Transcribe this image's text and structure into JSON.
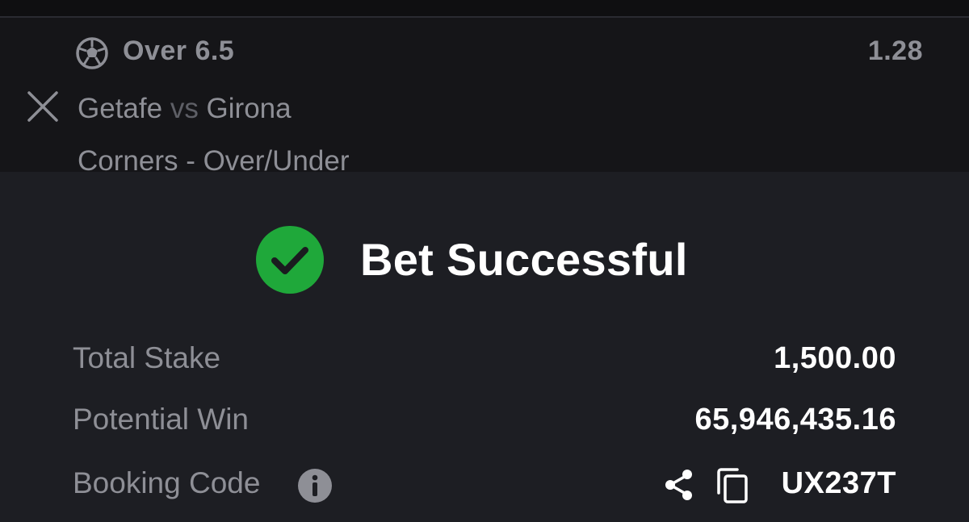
{
  "bet": {
    "selection": "Over 6.5",
    "odds": "1.28",
    "match_home": "Getafe",
    "match_vs": "vs",
    "match_away": "Girona",
    "market": "Corners - Over/Under",
    "sport_icon": "soccer-ball-icon"
  },
  "success": {
    "title": "Bet Successful",
    "icon": "check-circle-icon",
    "icon_color": "#1fa83a"
  },
  "summary": {
    "total_stake_label": "Total Stake",
    "total_stake_value": "1,500.00",
    "potential_win_label": "Potential Win",
    "potential_win_value": "65,946,435.16",
    "booking_code_label": "Booking Code",
    "booking_code_value": "UX237T"
  },
  "colors": {
    "sheet_background": "#1d1e23",
    "muted_text": "#8e8f96",
    "primary_text": "#ffffff"
  }
}
